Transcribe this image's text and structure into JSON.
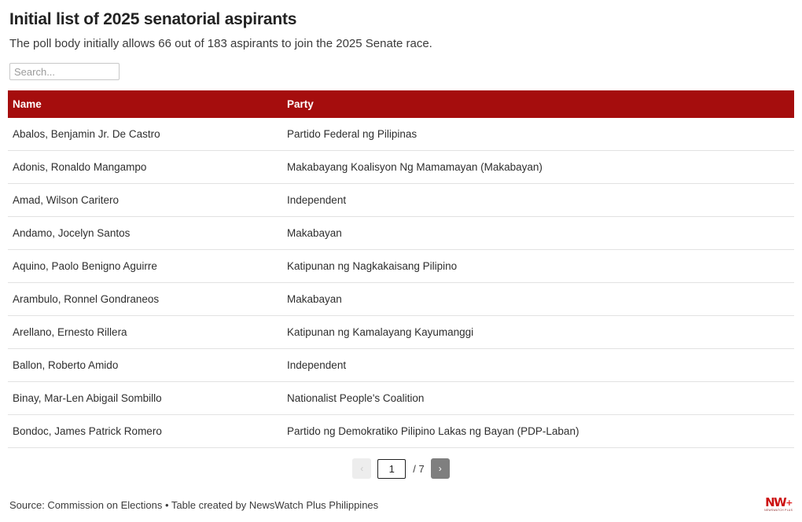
{
  "header": {
    "title": "Initial list of 2025 senatorial aspirants",
    "subtitle": "The poll body initially allows 66 out of 183 aspirants to join the 2025 Senate race."
  },
  "search": {
    "placeholder": "Search...",
    "value": ""
  },
  "table": {
    "columns": [
      "Name",
      "Party"
    ],
    "rows": [
      [
        "Abalos, Benjamin Jr. De Castro",
        "Partido Federal ng Pilipinas"
      ],
      [
        "Adonis, Ronaldo Mangampo",
        "Makabayang Koalisyon Ng Mamamayan (Makabayan)"
      ],
      [
        "Amad, Wilson Caritero",
        "Independent"
      ],
      [
        "Andamo, Jocelyn Santos",
        "Makabayan"
      ],
      [
        "Aquino, Paolo Benigno Aguirre",
        "Katipunan ng Nagkakaisang Pilipino"
      ],
      [
        "Arambulo, Ronnel Gondraneos",
        "Makabayan"
      ],
      [
        "Arellano, Ernesto Rillera",
        "Katipunan ng Kamalayang Kayumanggi"
      ],
      [
        "Ballon, Roberto Amido",
        "Independent"
      ],
      [
        "Binay, Mar-Len Abigail Sombillo",
        "Nationalist People's Coalition"
      ],
      [
        "Bondoc, James Patrick Romero",
        "Partido ng Demokratiko Pilipino Lakas ng Bayan (PDP-Laban)"
      ]
    ]
  },
  "pagination": {
    "prev_label": "‹",
    "next_label": "›",
    "current_page": "1",
    "total_pages_label": "/ 7"
  },
  "footer": {
    "source": "Source: Commission on Elections • Table created by NewsWatch Plus Philippines",
    "logo_mark": "NW",
    "logo_plus": "+",
    "logo_sub": "NEWSWATCH PLUS"
  },
  "colors": {
    "header_red": "#a50d0d",
    "logo_red": "#cc1111",
    "next_button": "#7f7f7f",
    "prev_button": "#ededed",
    "row_border": "#e2e2e2"
  }
}
